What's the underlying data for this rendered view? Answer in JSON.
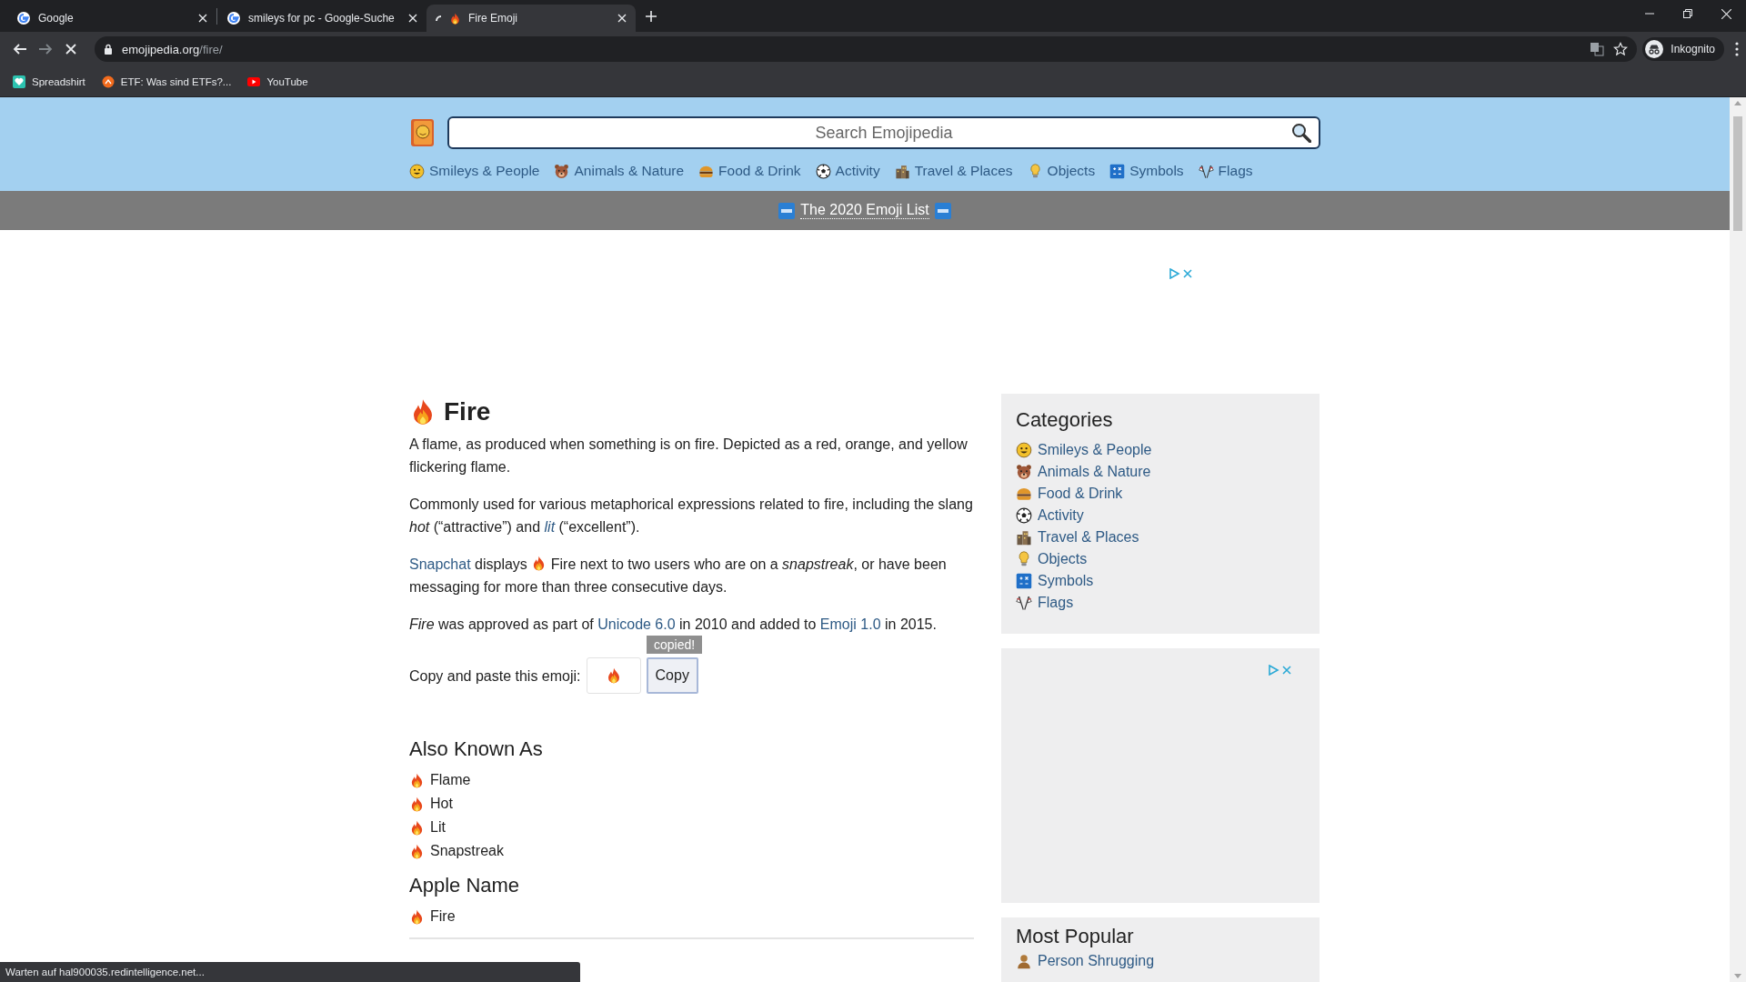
{
  "browser": {
    "tabs": [
      {
        "title": "Google",
        "kind": "google",
        "selected": false
      },
      {
        "title": "smileys for pc - Google-Suche",
        "kind": "google",
        "selected": false
      },
      {
        "title": "Fire Emoji",
        "kind": "loading",
        "selected": true
      }
    ],
    "address": {
      "domain": "emojipedia.org",
      "path": "/fire/"
    },
    "profile": "Inkognito",
    "bookmarks": [
      {
        "title": "Spreadshirt",
        "kind": "spreadshirt"
      },
      {
        "title": "ETF: Was sind ETFs?...",
        "kind": "etf"
      },
      {
        "title": "YouTube",
        "kind": "youtube"
      }
    ]
  },
  "header": {
    "search": {
      "placeholder": "Search Emojipedia"
    },
    "nav": [
      {
        "label": "Smileys & People",
        "kind": "smiley"
      },
      {
        "label": "Animals & Nature",
        "kind": "bear"
      },
      {
        "label": "Food & Drink",
        "kind": "burger"
      },
      {
        "label": "Activity",
        "kind": "ball"
      },
      {
        "label": "Travel & Places",
        "kind": "city"
      },
      {
        "label": "Objects",
        "kind": "bulb"
      },
      {
        "label": "Symbols",
        "kind": "symbols"
      },
      {
        "label": "Flags",
        "kind": "flags"
      }
    ],
    "banner": {
      "text": "The 2020 Emoji List"
    }
  },
  "article": {
    "title": "Fire",
    "paragraphs": [
      [
        {
          "kind": "text",
          "text": "A flame, as produced when something is on fire. Depicted as a red, orange, and yellow flickering flame."
        }
      ],
      [
        {
          "kind": "text",
          "text": "Commonly used for various metaphorical expressions related to fire, including the slang *hot* (“attractive”) and "
        },
        {
          "kind": "link",
          "text": "*lit*"
        },
        {
          "kind": "text",
          "text": " (“excellent”)."
        }
      ],
      [
        {
          "kind": "link",
          "text": "Snapchat"
        },
        {
          "kind": "text",
          "text": " displays "
        },
        {
          "kind": "fire"
        },
        {
          "kind": "text",
          "text": " Fire next to two users who are on a *snapstreak*, or have been messaging for more than three consecutive days."
        }
      ],
      [
        {
          "kind": "text",
          "text": "*Fire* was approved as part of "
        },
        {
          "kind": "link",
          "text": "Unicode 6.0"
        },
        {
          "kind": "text",
          "text": " in 2010 and added to "
        },
        {
          "kind": "link",
          "text": "Emoji 1.0"
        },
        {
          "kind": "text",
          "text": " in 2015."
        }
      ]
    ],
    "copy": {
      "label": "Copy and paste this emoji:",
      "button": "Copy",
      "tooltip": "copied!"
    },
    "sections": [
      {
        "title": "Also Known As",
        "items": [
          "Flame",
          "Hot",
          "Lit",
          "Snapstreak"
        ]
      },
      {
        "title": "Apple Name",
        "items": [
          "Fire"
        ]
      }
    ]
  },
  "sidebar": {
    "categories": {
      "title": "Categories",
      "items": [
        {
          "label": "Smileys & People",
          "kind": "smiley"
        },
        {
          "label": "Animals & Nature",
          "kind": "bear"
        },
        {
          "label": "Food & Drink",
          "kind": "burger"
        },
        {
          "label": "Activity",
          "kind": "ball"
        },
        {
          "label": "Travel & Places",
          "kind": "city"
        },
        {
          "label": "Objects",
          "kind": "bulb"
        },
        {
          "label": "Symbols",
          "kind": "symbols"
        },
        {
          "label": "Flags",
          "kind": "flags"
        }
      ]
    },
    "popular": {
      "title": "Most Popular",
      "items": [
        {
          "label": "Person Shrugging",
          "kind": "person"
        }
      ]
    }
  },
  "status_bar": "Warten auf hal900035.redintelligence.net..."
}
